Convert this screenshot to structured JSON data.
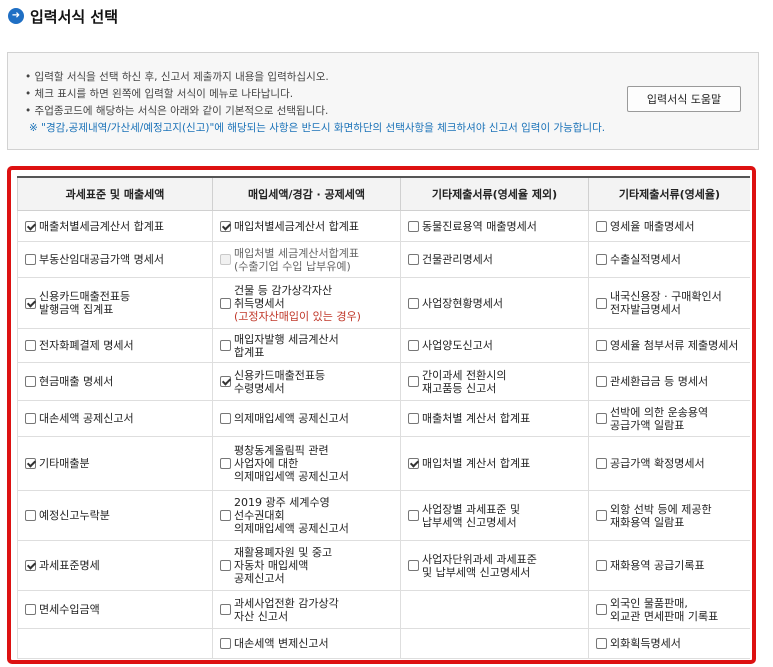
{
  "title": "입력서식 선택",
  "info": {
    "lines": [
      "• 입력할 서식을 선택 하신 후, 신고서 제출까지 내용을 입력하십시오.",
      "• 체크 표시를 하면 왼쪽에 입력할 서식이 메뉴로 나타납니다.",
      "• 주업종코드에 해당하는 서식은 아래와 같이 기본적으로 선택됩니다."
    ],
    "note": "※ \"경감,공제내역/가산세/예정고지(신고)\"에 해당되는 사항은 반드시 화면하단의 선택사항을 체크하셔야 신고서 입력이 가능합니다.",
    "help_button": "입력서식 도움말"
  },
  "table": {
    "headers": [
      "과세표준 및 매출세액",
      "매입세액/경감 · 공제세액",
      "기타제출서류(영세율 제외)",
      "기타제출서류(영세율)"
    ],
    "rows": [
      [
        {
          "label": "매출처별세금계산서 합계표",
          "checked": true
        },
        {
          "label": "매입처별세금계산서 합계표",
          "checked": true
        },
        {
          "label": "동물진료용역 매출명세서",
          "checked": false
        },
        {
          "label": "영세율 매출명세서",
          "checked": false
        }
      ],
      [
        {
          "label": "부동산임대공급가액 명세서",
          "checked": false
        },
        {
          "label": "매입처별 세금계산서합계표\n(수출기업 수입 납부유예)",
          "checked": false,
          "disabled": true
        },
        {
          "label": "건물관리명세서",
          "checked": false
        },
        {
          "label": "수출실적명세서",
          "checked": false
        }
      ],
      [
        {
          "label": "신용카드매출전표등\n발행금액 집계표",
          "checked": true
        },
        {
          "label": "건물 등 감가상각자산\n취득명세서",
          "checked": false,
          "extra": "(고정자산매입이 있는 경우)"
        },
        {
          "label": "사업장현황명세서",
          "checked": false
        },
        {
          "label": "내국신용장 · 구매확인서\n전자발급명세서",
          "checked": false
        }
      ],
      [
        {
          "label": "전자화폐결제 명세서",
          "checked": false
        },
        {
          "label": "매입자발행 세금계산서\n합계표",
          "checked": false
        },
        {
          "label": "사업양도신고서",
          "checked": false
        },
        {
          "label": "영세율 첨부서류 제출명세서",
          "checked": false
        }
      ],
      [
        {
          "label": "현금매출 명세서",
          "checked": false
        },
        {
          "label": "신용카드매출전표등\n수령명세서",
          "checked": true
        },
        {
          "label": "간이과세 전환시의\n재고품등 신고서",
          "checked": false
        },
        {
          "label": "관세환급금 등 명세서",
          "checked": false
        }
      ],
      [
        {
          "label": "대손세액 공제신고서",
          "checked": false
        },
        {
          "label": "의제매입세액 공제신고서",
          "checked": false
        },
        {
          "label": "매출처별 계산서 합계표",
          "checked": false
        },
        {
          "label": "선박에 의한 운송용역\n공급가액 일람표",
          "checked": false
        }
      ],
      [
        {
          "label": "기타매출분",
          "checked": true
        },
        {
          "label": "평창동계올림픽 관련\n사업자에 대한\n의제매입세액 공제신고서",
          "checked": false
        },
        {
          "label": "매입처별 계산서 합계표",
          "checked": true
        },
        {
          "label": "공급가액 확정명세서",
          "checked": false
        }
      ],
      [
        {
          "label": "예정신고누락분",
          "checked": false
        },
        {
          "label": "2019 광주 세계수영\n선수권대회\n의제매입세액 공제신고서",
          "checked": false
        },
        {
          "label": "사업장별 과세표준 및\n납부세액 신고명세서",
          "checked": false
        },
        {
          "label": "외항 선박 등에 제공한\n재화용역 일람표",
          "checked": false
        }
      ],
      [
        {
          "label": "과세표준명세",
          "checked": true
        },
        {
          "label": "재활용폐자원 및 중고\n자동차 매입세액\n공제신고서",
          "checked": false
        },
        {
          "label": "사업자단위과세 과세표준\n및 납부세액 신고명세서",
          "checked": false
        },
        {
          "label": "재화용역 공급기록표",
          "checked": false
        }
      ],
      [
        {
          "label": "면세수입금액",
          "checked": false
        },
        {
          "label": "과세사업전환 감가상각\n자산 신고서",
          "checked": false
        },
        null,
        {
          "label": "외국인 물품판매,\n외교관 면세판매 기록표",
          "checked": false
        }
      ],
      [
        null,
        {
          "label": "대손세액 변제신고서",
          "checked": false
        },
        null,
        {
          "label": "외화획득명세서",
          "checked": false
        }
      ]
    ]
  }
}
